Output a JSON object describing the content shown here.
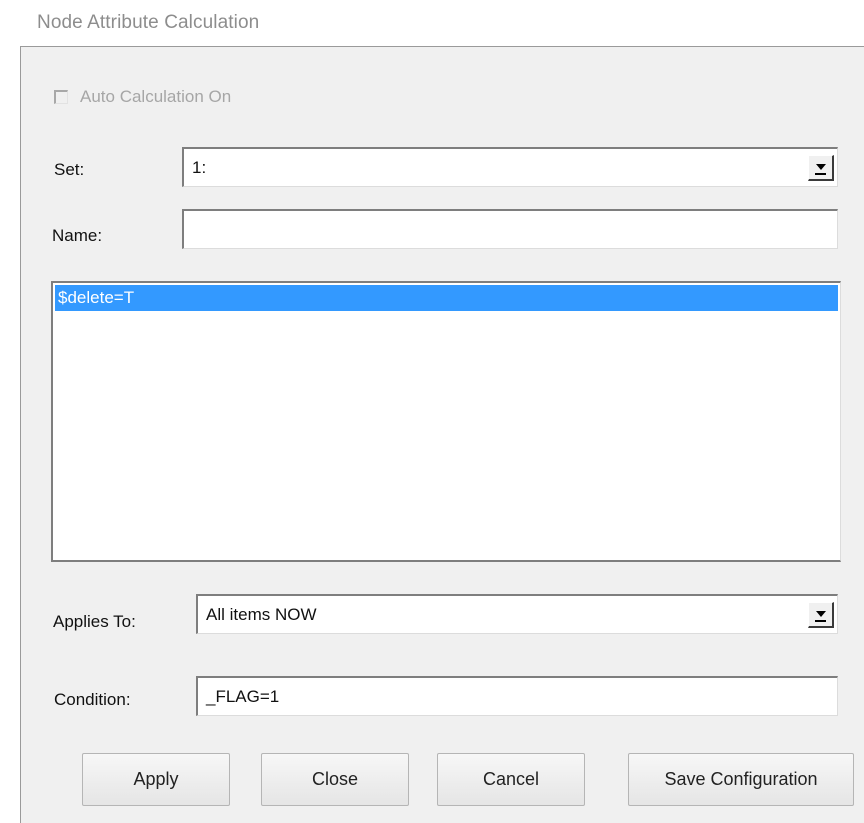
{
  "window": {
    "title": "Node Attribute Calculation"
  },
  "auto_calc": {
    "label": "Auto Calculation On",
    "checked": false,
    "enabled": false
  },
  "set": {
    "label": "Set:",
    "value": "1:"
  },
  "name": {
    "label": "Name:",
    "value": ""
  },
  "expressions": {
    "items": [
      "$delete=T"
    ],
    "selected_index": 0
  },
  "applies_to": {
    "label": "Applies To:",
    "value": "All items NOW"
  },
  "condition": {
    "label": "Condition:",
    "value": "_FLAG=1"
  },
  "buttons": {
    "apply": "Apply",
    "close": "Close",
    "cancel": "Cancel",
    "save_configuration": "Save Configuration"
  },
  "colors": {
    "selection": "#3399ff",
    "dialog_background": "#f0f0f0"
  },
  "icons": {
    "dropdown": "chevron-down-icon"
  }
}
